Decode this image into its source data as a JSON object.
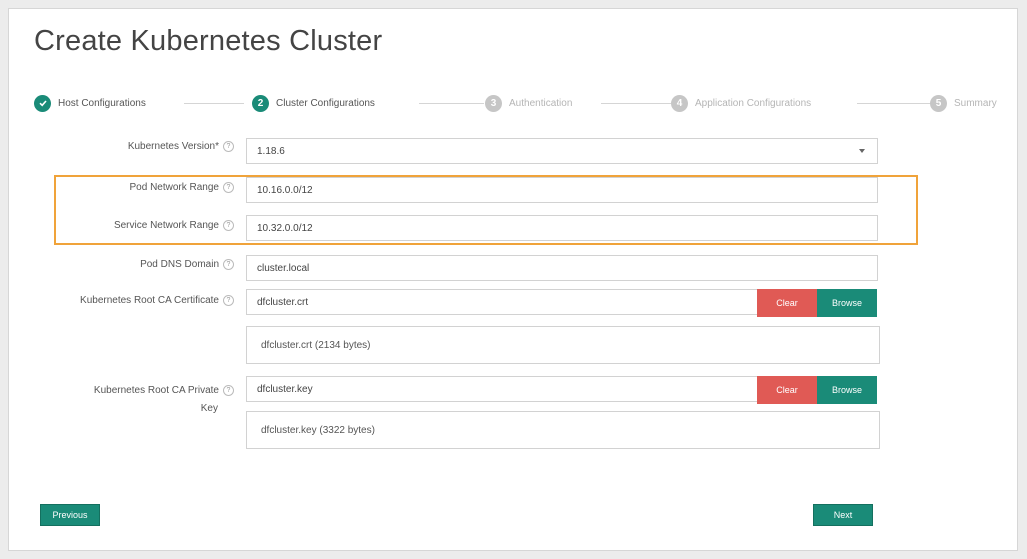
{
  "page": {
    "title": "Create Kubernetes Cluster"
  },
  "steps": [
    {
      "number": "1",
      "label": "Host Configurations",
      "state": "done"
    },
    {
      "number": "2",
      "label": "Cluster Configurations",
      "state": "active"
    },
    {
      "number": "3",
      "label": "Authentication",
      "state": "todo"
    },
    {
      "number": "4",
      "label": "Application Configurations",
      "state": "todo"
    },
    {
      "number": "5",
      "label": "Summary",
      "state": "todo"
    }
  ],
  "form": {
    "kubernetes_version": {
      "label": "Kubernetes Version*",
      "value": "1.18.6"
    },
    "pod_network_range": {
      "label": "Pod Network Range",
      "value": "10.16.0.0/12"
    },
    "service_network_range": {
      "label": "Service Network Range",
      "value": "10.32.0.0/12"
    },
    "pod_dns_domain": {
      "label": "Pod DNS Domain",
      "value": "cluster.local"
    },
    "root_ca_certificate": {
      "label": "Kubernetes Root CA Certificate",
      "value": "dfcluster.crt",
      "file_info": "dfcluster.crt (2134 bytes)",
      "clear_label": "Clear",
      "browse_label": "Browse"
    },
    "root_ca_private_key": {
      "label_line1": "Kubernetes Root CA Private",
      "label_line2": "Key",
      "value": "dfcluster.key",
      "file_info": "dfcluster.key (3322 bytes)",
      "clear_label": "Clear",
      "browse_label": "Browse"
    }
  },
  "help_icon_glyph": "?",
  "footer": {
    "previous_label": "Previous",
    "next_label": "Next"
  },
  "colors": {
    "accent": "#1a8b78",
    "danger": "#e05a55",
    "highlight": "#f0a33a"
  }
}
